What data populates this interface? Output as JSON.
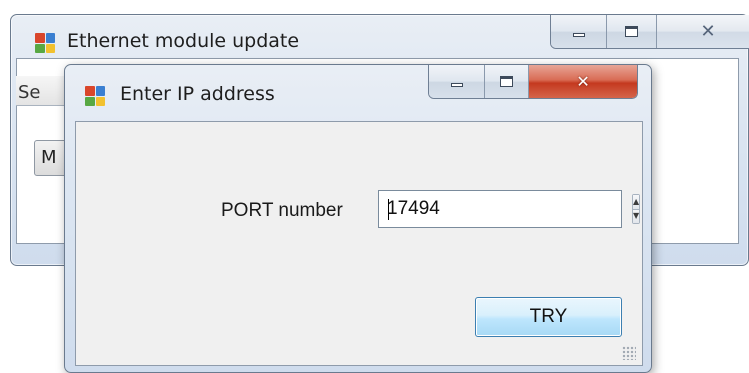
{
  "main_window": {
    "title": "Ethernet module update",
    "tab_label_partial": "Se",
    "button_label_partial": "M"
  },
  "dialog": {
    "title": "Enter IP address",
    "port_label": "PORT number",
    "port_value": "17494",
    "try_label": "TRY"
  },
  "icons": {
    "app": "app-window-icon",
    "minimize": "minimize-icon",
    "maximize": "maximize-icon",
    "close": "close-icon",
    "spin_up": "chevron-up-icon",
    "spin_down": "chevron-down-icon",
    "resize": "resize-grip-icon"
  },
  "colors": {
    "icon_red": "#d9462b",
    "icon_blue": "#3a7fd1",
    "icon_green": "#58a843",
    "icon_yellow": "#f2c12e",
    "close_red": "#c4391f",
    "accent_blue": "#3c7fb1"
  }
}
